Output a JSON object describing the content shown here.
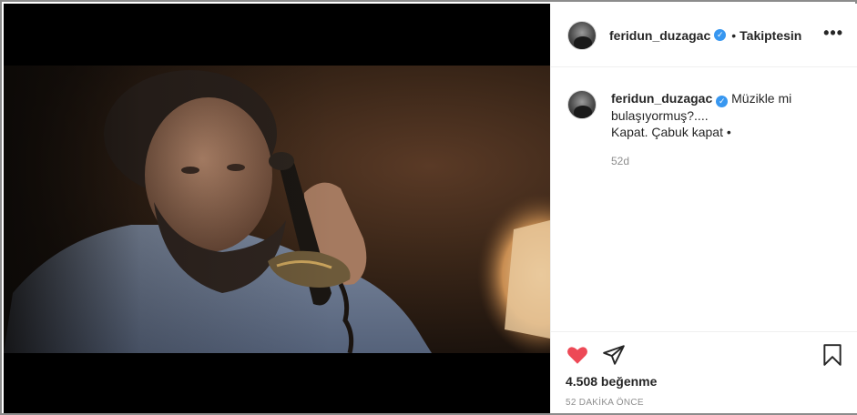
{
  "post": {
    "author": {
      "username": "feridun_duzagac",
      "verified_mark": "✓",
      "separator": "•",
      "follow_status": "Takiptesin"
    },
    "more_label": "•••",
    "caption": {
      "username": "feridun_duzagac",
      "verified_mark": "✓",
      "line1": "Müzikle mi bulaşıyormuş?....",
      "line2": "Kapat. Çabuk kapat •"
    },
    "caption_age": "52d",
    "likes": "4.508 beğenme",
    "posted_ago": "52 DAKİKA ÖNCE",
    "icons": {
      "like": "heart-icon",
      "share": "share-icon",
      "save": "bookmark-icon"
    },
    "colors": {
      "like": "#ed4956",
      "verified": "#3897f0"
    }
  }
}
